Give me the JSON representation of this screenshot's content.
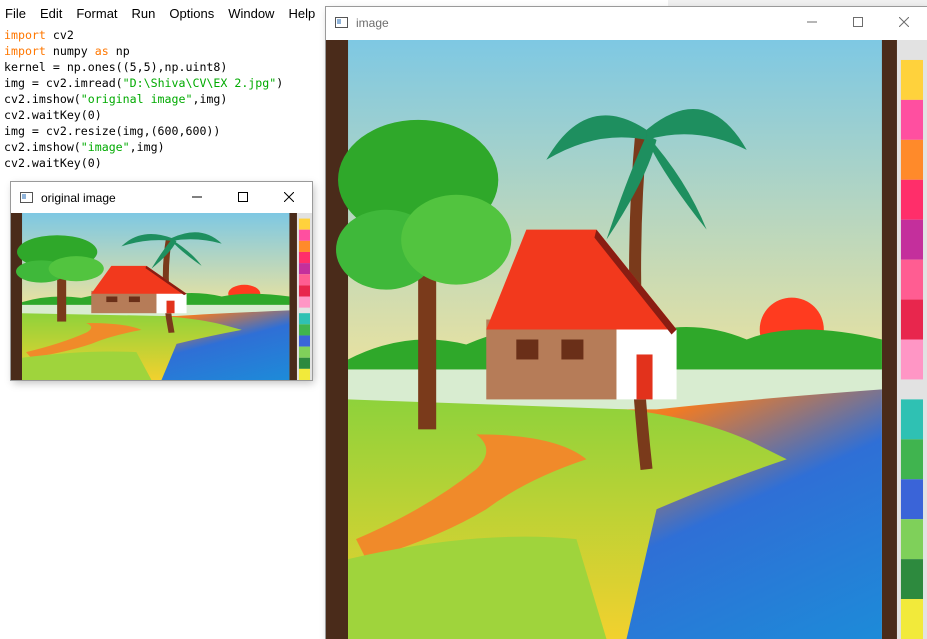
{
  "editor": {
    "menu": [
      "File",
      "Edit",
      "Format",
      "Run",
      "Options",
      "Window",
      "Help"
    ],
    "code_lines": [
      [
        {
          "t": "import",
          "c": "kw"
        },
        {
          "t": " cv2",
          "c": ""
        }
      ],
      [
        {
          "t": "import",
          "c": "kw"
        },
        {
          "t": " numpy ",
          "c": ""
        },
        {
          "t": "as",
          "c": "kw"
        },
        {
          "t": " np",
          "c": ""
        }
      ],
      [
        {
          "t": "kernel = np.ones((5,5),np.uint8)",
          "c": ""
        }
      ],
      [
        {
          "t": "img = cv2.imread(",
          "c": ""
        },
        {
          "t": "\"D:\\Shiva\\CV\\EX 2.jpg\"",
          "c": "str"
        },
        {
          "t": ")",
          "c": ""
        }
      ],
      [
        {
          "t": "cv2.imshow(",
          "c": ""
        },
        {
          "t": "\"original image\"",
          "c": "str"
        },
        {
          "t": ",img)",
          "c": ""
        }
      ],
      [
        {
          "t": "cv2.waitKey(0)",
          "c": ""
        }
      ],
      [
        {
          "t": "img = cv2.resize(img,(600,600))",
          "c": ""
        }
      ],
      [
        {
          "t": "cv2.imshow(",
          "c": ""
        },
        {
          "t": "\"image\"",
          "c": "str"
        },
        {
          "t": ",img)",
          "c": ""
        }
      ],
      [
        {
          "t": "cv2.waitKey(0)",
          "c": ""
        }
      ]
    ],
    "colors": {
      "keyword": "#ff7700",
      "string": "#00aa00",
      "text": "#000000"
    }
  },
  "windows": {
    "original": {
      "title": "original image",
      "active": true
    },
    "image": {
      "title": "image",
      "active": false
    }
  },
  "icons": {
    "window_icon": "opencv-window-icon",
    "minimize": "minimize-icon",
    "maximize": "maximize-icon",
    "close": "close-icon"
  },
  "painting_colors": {
    "sky_top": "#7ec8e3",
    "sky_bottom": "#f7d34a",
    "sun": "#ff3b1f",
    "roof": "#f2391d",
    "wall": "#ffffff",
    "tree": "#2fa82a",
    "water": "#2f6fd6",
    "grass": "#8ed23b",
    "path": "#f08a2a",
    "frame": "#4a2b1a"
  }
}
